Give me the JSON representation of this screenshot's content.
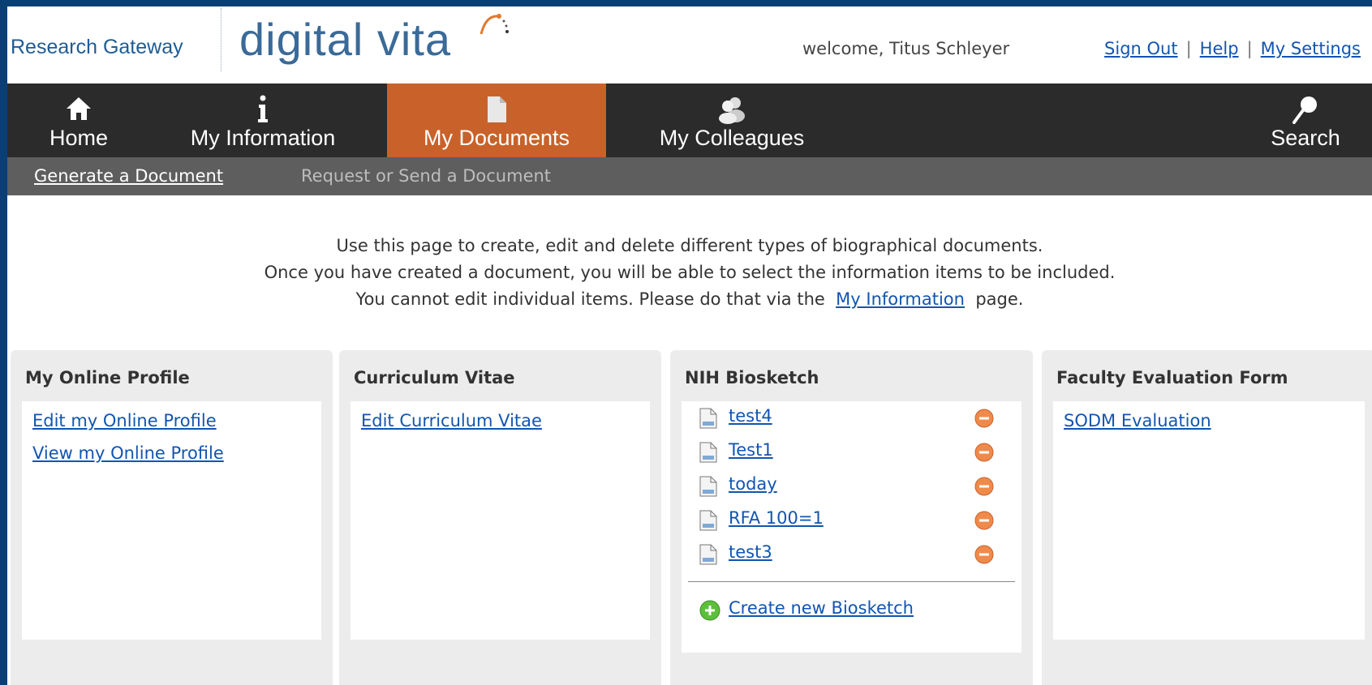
{
  "header": {
    "brand_small": "Research Gateway",
    "brand_large": "digital vita",
    "welcome": "welcome, Titus Schleyer",
    "links": [
      "Sign Out",
      "Help",
      "My Settings"
    ]
  },
  "nav": {
    "items": [
      {
        "label": "Home",
        "icon": "home-icon"
      },
      {
        "label": "My Information",
        "icon": "info-icon"
      },
      {
        "label": "My Documents",
        "icon": "document-icon",
        "active": true
      },
      {
        "label": "My Colleagues",
        "icon": "colleagues-icon"
      },
      {
        "label": "Search",
        "icon": "search-icon"
      }
    ],
    "active_color": "#c8622a"
  },
  "subnav": {
    "items": [
      "Generate a Document",
      "Request or Send a Document"
    ]
  },
  "intro": {
    "line1": "Use this page to create, edit and delete different types of biographical documents.",
    "line2": "Once you have created a document, you will be able to select the information items to be included.",
    "line3_pre": "You cannot edit individual items. Please do that via the",
    "line3_link": "My Information",
    "line3_post": "page."
  },
  "panels": {
    "profile": {
      "title": "My Online Profile",
      "links": [
        "Edit my Online Profile",
        "View my Online Profile"
      ]
    },
    "cv": {
      "title": "Curriculum Vitae",
      "links": [
        "Edit Curriculum Vitae"
      ]
    },
    "nih": {
      "title": "NIH Biosketch",
      "documents": [
        "test4",
        "Test1",
        "today",
        "RFA 100=1",
        "test3"
      ],
      "create_label": "Create new Biosketch"
    },
    "faculty": {
      "title": "Faculty Evaluation Form",
      "links": [
        "SODM Evaluation"
      ]
    }
  }
}
